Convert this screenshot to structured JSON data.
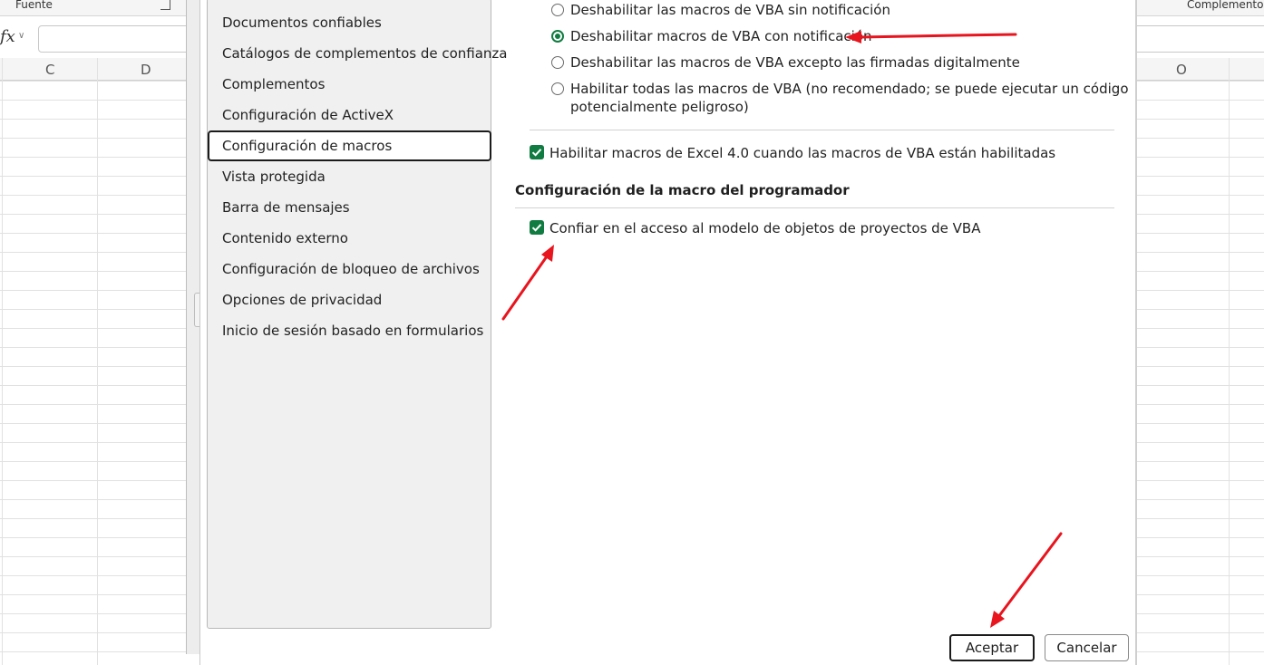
{
  "excel": {
    "ribbon_group_left": "Fuente",
    "ribbon_group_right": "Complementos",
    "fx_label": "fx",
    "columns": [
      "C",
      "D",
      "O"
    ]
  },
  "nav": {
    "items": [
      {
        "label": "Documentos confiables"
      },
      {
        "label": "Catálogos de complementos de confianza"
      },
      {
        "label": "Complementos"
      },
      {
        "label": "Configuración de ActiveX"
      },
      {
        "label": "Configuración de macros",
        "selected": true
      },
      {
        "label": "Vista protegida"
      },
      {
        "label": "Barra de mensajes"
      },
      {
        "label": "Contenido externo"
      },
      {
        "label": "Configuración de bloqueo de archivos"
      },
      {
        "label": "Opciones de privacidad"
      },
      {
        "label": "Inicio de sesión basado en formularios"
      }
    ]
  },
  "macro_settings": {
    "options": [
      {
        "label": "Deshabilitar las macros de VBA sin notificación",
        "selected": false
      },
      {
        "label": "Deshabilitar macros de VBA con notificación",
        "selected": true
      },
      {
        "label": "Deshabilitar las macros de VBA excepto las firmadas digitalmente",
        "selected": false
      },
      {
        "label_line1": "Habilitar todas las macros de VBA (no recomendado; se puede ejecutar un código",
        "label_line2": "potencialmente peligroso)",
        "selected": false
      }
    ],
    "excel4_checkbox": {
      "label": "Habilitar macros de Excel 4.0 cuando las macros de VBA están habilitadas",
      "checked": true
    }
  },
  "developer_section": {
    "title": "Configuración de la macro del programador",
    "trust_checkbox": {
      "label": "Confiar en el acceso al modelo de objetos de proyectos de VBA",
      "checked": true
    }
  },
  "buttons": {
    "ok": "Aceptar",
    "cancel": "Cancelar"
  },
  "colors": {
    "accent": "#107c41",
    "annotation": "#e8141e"
  }
}
